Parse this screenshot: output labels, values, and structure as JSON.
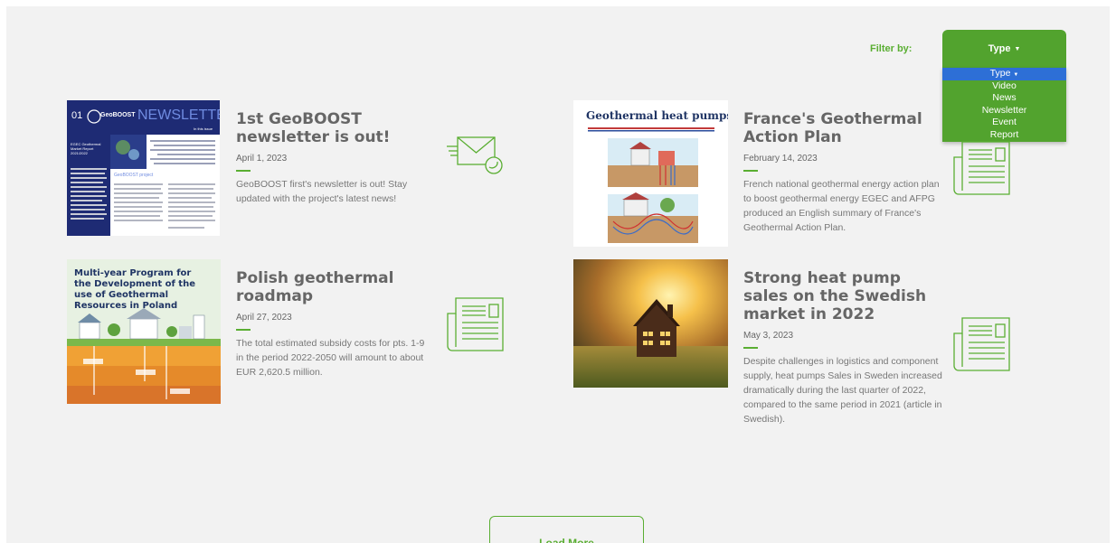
{
  "filter": {
    "label": "Filter by:",
    "selected": "Type",
    "options": [
      "Type",
      "Video",
      "News",
      "Newsletter",
      "Event",
      "Report"
    ]
  },
  "cards": [
    {
      "title": "1st GeoBOOST newsletter is out!",
      "date": "April 1, 2023",
      "description": "GeoBOOST first's newsletter is out! Stay updated with the project's latest news!",
      "type_icon": "envelope-icon",
      "thumb": {
        "number": "01",
        "brand": "GeoBOOST",
        "heading": "NEWSLETTER",
        "subheading": "In this issue",
        "section": "GeoBOOST project",
        "side_text": "EGEC Geothermal Market Report 2021/2022"
      }
    },
    {
      "title": "France's Geothermal Action Plan",
      "date": "February 14, 2023",
      "description": "French national geothermal energy action plan to boost geothermal energy EGEC and AFPG produced an English summary of France's Geothermal Action Plan.",
      "type_icon": "newspaper-icon",
      "thumb": {
        "heading": "Geothermal heat pumps"
      }
    },
    {
      "title": "Polish geothermal roadmap",
      "date": "April 27, 2023",
      "description": "The total estimated subsidy costs for pts. 1-9 in the period 2022-2050 will amount to about EUR 2,620.5 million.",
      "type_icon": "newspaper-icon",
      "thumb": {
        "heading": "Multi-year Program for the Development of the use of Geothermal Resources in Poland"
      }
    },
    {
      "title": "Strong heat pump sales on the Swedish market in 2022",
      "date": "May 3, 2023",
      "description": "Despite challenges in logistics and component supply, heat pumps Sales in Sweden increased dramatically during the last quarter of 2022, compared to the same period in 2021 (article in Swedish).",
      "type_icon": "newspaper-icon",
      "thumb": {}
    }
  ],
  "load_more": "Load More",
  "colors": {
    "accent": "#52a32e",
    "selected": "#2d6fd6",
    "background": "#f2f2f2",
    "title": "#666666"
  }
}
